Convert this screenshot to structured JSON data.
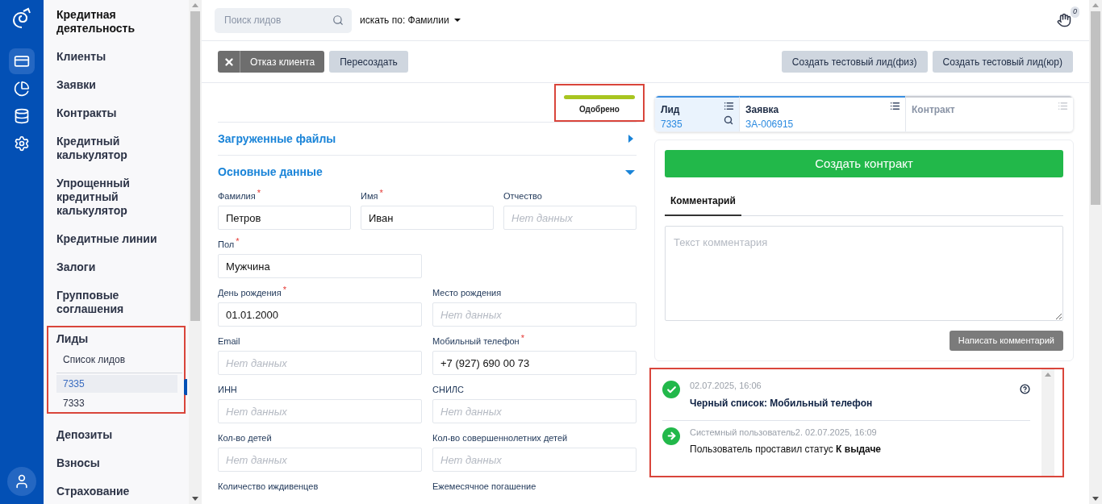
{
  "rail": {
    "items": [
      {
        "kind": "card",
        "selected": true
      },
      {
        "kind": "chart",
        "selected": false
      },
      {
        "kind": "database",
        "selected": false
      },
      {
        "kind": "settings",
        "selected": false
      }
    ]
  },
  "nav": {
    "items": [
      {
        "label": "Кредитная деятельность",
        "kind": "heading"
      },
      {
        "label": "Клиенты",
        "kind": "item"
      },
      {
        "label": "Заявки",
        "kind": "item"
      },
      {
        "label": "Контракты",
        "kind": "item"
      },
      {
        "label": "Кредитный калькулятор",
        "kind": "item"
      },
      {
        "label": "Упрощенный кредитный калькулятор",
        "kind": "item"
      },
      {
        "label": "Кредитные линии",
        "kind": "item"
      },
      {
        "label": "Залоги",
        "kind": "item"
      },
      {
        "label": "Групповые соглашения",
        "kind": "item"
      },
      {
        "label": "Лиды",
        "kind": "item",
        "highlighted": true,
        "children": [
          {
            "label": "Список лидов",
            "children": [
              {
                "label": "7335",
                "selected": true
              },
              {
                "label": "7333",
                "selected": false
              }
            ]
          }
        ]
      },
      {
        "label": "Депозиты",
        "kind": "item"
      },
      {
        "label": "Взносы",
        "kind": "item"
      },
      {
        "label": "Страхование",
        "kind": "item"
      }
    ]
  },
  "header": {
    "search": {
      "placeholder": "Поиск лидов"
    },
    "search_by": "искать по: Фамилии",
    "notifications_badge": "0"
  },
  "toolbar": {
    "left": [
      {
        "label": "Отказ клиента",
        "kind": "dark"
      },
      {
        "label": "Пересоздать",
        "kind": "light"
      }
    ],
    "right": [
      {
        "label": "Создать тестовый лид(физ)"
      },
      {
        "label": "Создать тестовый лид(юр)"
      }
    ]
  },
  "status": {
    "label": "Одобрено",
    "color": "#a8c520",
    "highlighted": true
  },
  "sections": [
    {
      "title": "Загруженные файлы",
      "expanded": false
    },
    {
      "title": "Основные данные",
      "expanded": true
    }
  ],
  "form_rows": [
    [
      {
        "label": "Фамилия",
        "required_mark": "*",
        "value": "Петров"
      },
      {
        "label": "Имя",
        "required_mark": "*",
        "value": "Иван"
      },
      {
        "label": "Отчество",
        "placeholder": "Нет данных"
      }
    ],
    [
      {
        "label": "Пол",
        "required_mark": "*",
        "value": "Мужчина"
      }
    ],
    [
      {
        "label": "День рождения",
        "required_mark": "*",
        "value": "01.01.2000"
      },
      {
        "label": "Место рождения",
        "placeholder": "Нет данных"
      }
    ],
    [
      {
        "label": "Email",
        "placeholder": "Нет данных"
      },
      {
        "label": "Мобильный телефон",
        "required_mark": "*",
        "value": "+7 (927) 690 00 73"
      }
    ],
    [
      {
        "label": "ИНН",
        "placeholder": "Нет данных"
      },
      {
        "label": "СНИЛС",
        "placeholder": "Нет данных"
      }
    ],
    [
      {
        "label": "Кол-во детей",
        "placeholder": "Нет данных"
      },
      {
        "label": "Кол-во совершеннолетних детей",
        "placeholder": "Нет данных"
      }
    ],
    [
      {
        "label": "Количество иждивенцев"
      },
      {
        "label": "Ежемесячное погашение"
      }
    ]
  ],
  "stage_tabs": [
    {
      "title": "Лид",
      "value": "7335",
      "selected": true,
      "disabled": false,
      "search": true
    },
    {
      "title": "Заявка",
      "value": "ЗА-006915",
      "selected": false,
      "disabled": false,
      "search": false
    },
    {
      "title": "Контракт",
      "selected": false,
      "disabled": true,
      "search": false
    }
  ],
  "create_contract": "Создать контракт",
  "comment": {
    "tab": "Комментарий",
    "placeholder": "Текст комментария",
    "submit": "Написать комментарий"
  },
  "history": {
    "highlighted": true,
    "items": [
      {
        "kind": "check",
        "meta": "02.07.2025, 16:06",
        "text": "**Черный список: Мобильный телефон**",
        "help": true
      },
      {
        "kind": "arrow",
        "meta": "Системный пользователь2. 02.07.2025, 16:09",
        "text": "Пользователь проставил статус **К выдаче**",
        "help": false
      }
    ]
  }
}
